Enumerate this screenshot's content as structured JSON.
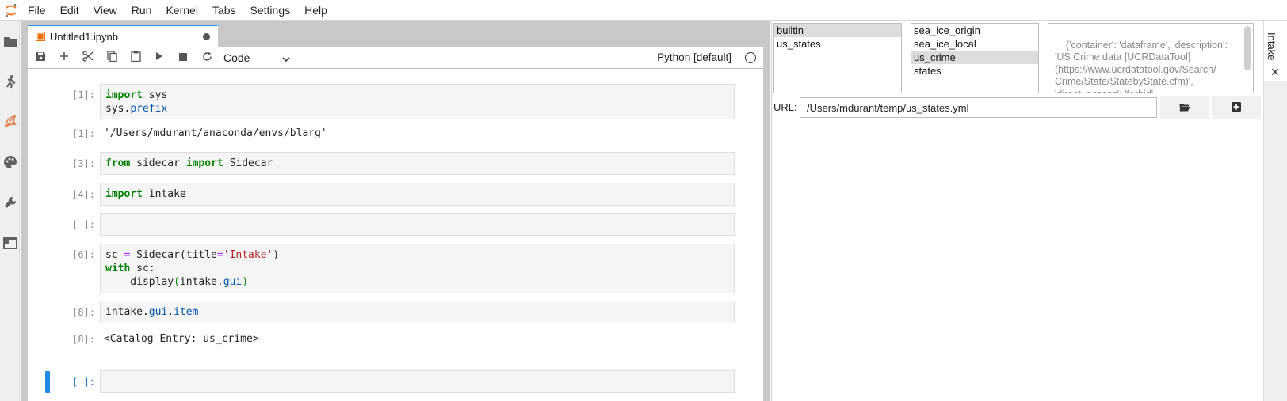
{
  "menu": [
    "File",
    "Edit",
    "View",
    "Run",
    "Kernel",
    "Tabs",
    "Settings",
    "Help"
  ],
  "tab": {
    "title": "Untitled1.ipynb"
  },
  "toolbar": {
    "cell_type": "Code",
    "kernel": "Python [default]"
  },
  "cells": {
    "c1": {
      "prompt": "[1]:",
      "line1": "sys",
      "line2": "sys.",
      "attr2": "prefix",
      "out_prompt": "[1]:",
      "output": "'/Users/mdurant/anaconda/envs/blarg'"
    },
    "c3": {
      "prompt": "[3]:",
      "mod": "sidecar",
      "name": "Sidecar"
    },
    "c4": {
      "prompt": "[4]:",
      "mod": "intake"
    },
    "c5": {
      "prompt": "[ ]:"
    },
    "c6": {
      "prompt": "[6]:",
      "l1a": "sc ",
      "l1b": " Sidecar(title",
      "l1c": "'Intake'",
      "l1d": ")",
      "l2": " sc:",
      "l3a": "    display",
      "l3b": "intake.",
      "l3c": "gui"
    },
    "c8": {
      "prompt": "[8]:",
      "a": "intake.",
      "b": "gui",
      "c": ".",
      "d": "item",
      "out_prompt": "[8]:",
      "output": "<Catalog Entry: us_crime>"
    },
    "c9": {
      "prompt": "[ ]:"
    }
  },
  "keywords": {
    "import": "import",
    "from": "from",
    "with": "with",
    "eq": "="
  },
  "sidecar": {
    "catalogs": [
      "builtin",
      "us_states"
    ],
    "selected_catalog": "builtin",
    "sources": [
      "sea_ice_origin",
      "sea_ice_local",
      "us_crime",
      "states"
    ],
    "selected_source": "us_crime",
    "description": "{'container': 'dataframe', 'description':\n'US Crime data [UCRDataTool]\n(https://www.ucrdatatool.gov/Search/\nCrime/State/StatebyState.cfm)',\n'direct_access': 'forbid',",
    "url_label": "URL:",
    "url_value": "/Users/mdurant/temp/us_states.yml"
  },
  "right_tab": {
    "label": "Intake",
    "close": "✕"
  },
  "colors": {
    "accent": "#2196f3",
    "active_cell": "#1e88e5",
    "logo": "#f37726"
  }
}
